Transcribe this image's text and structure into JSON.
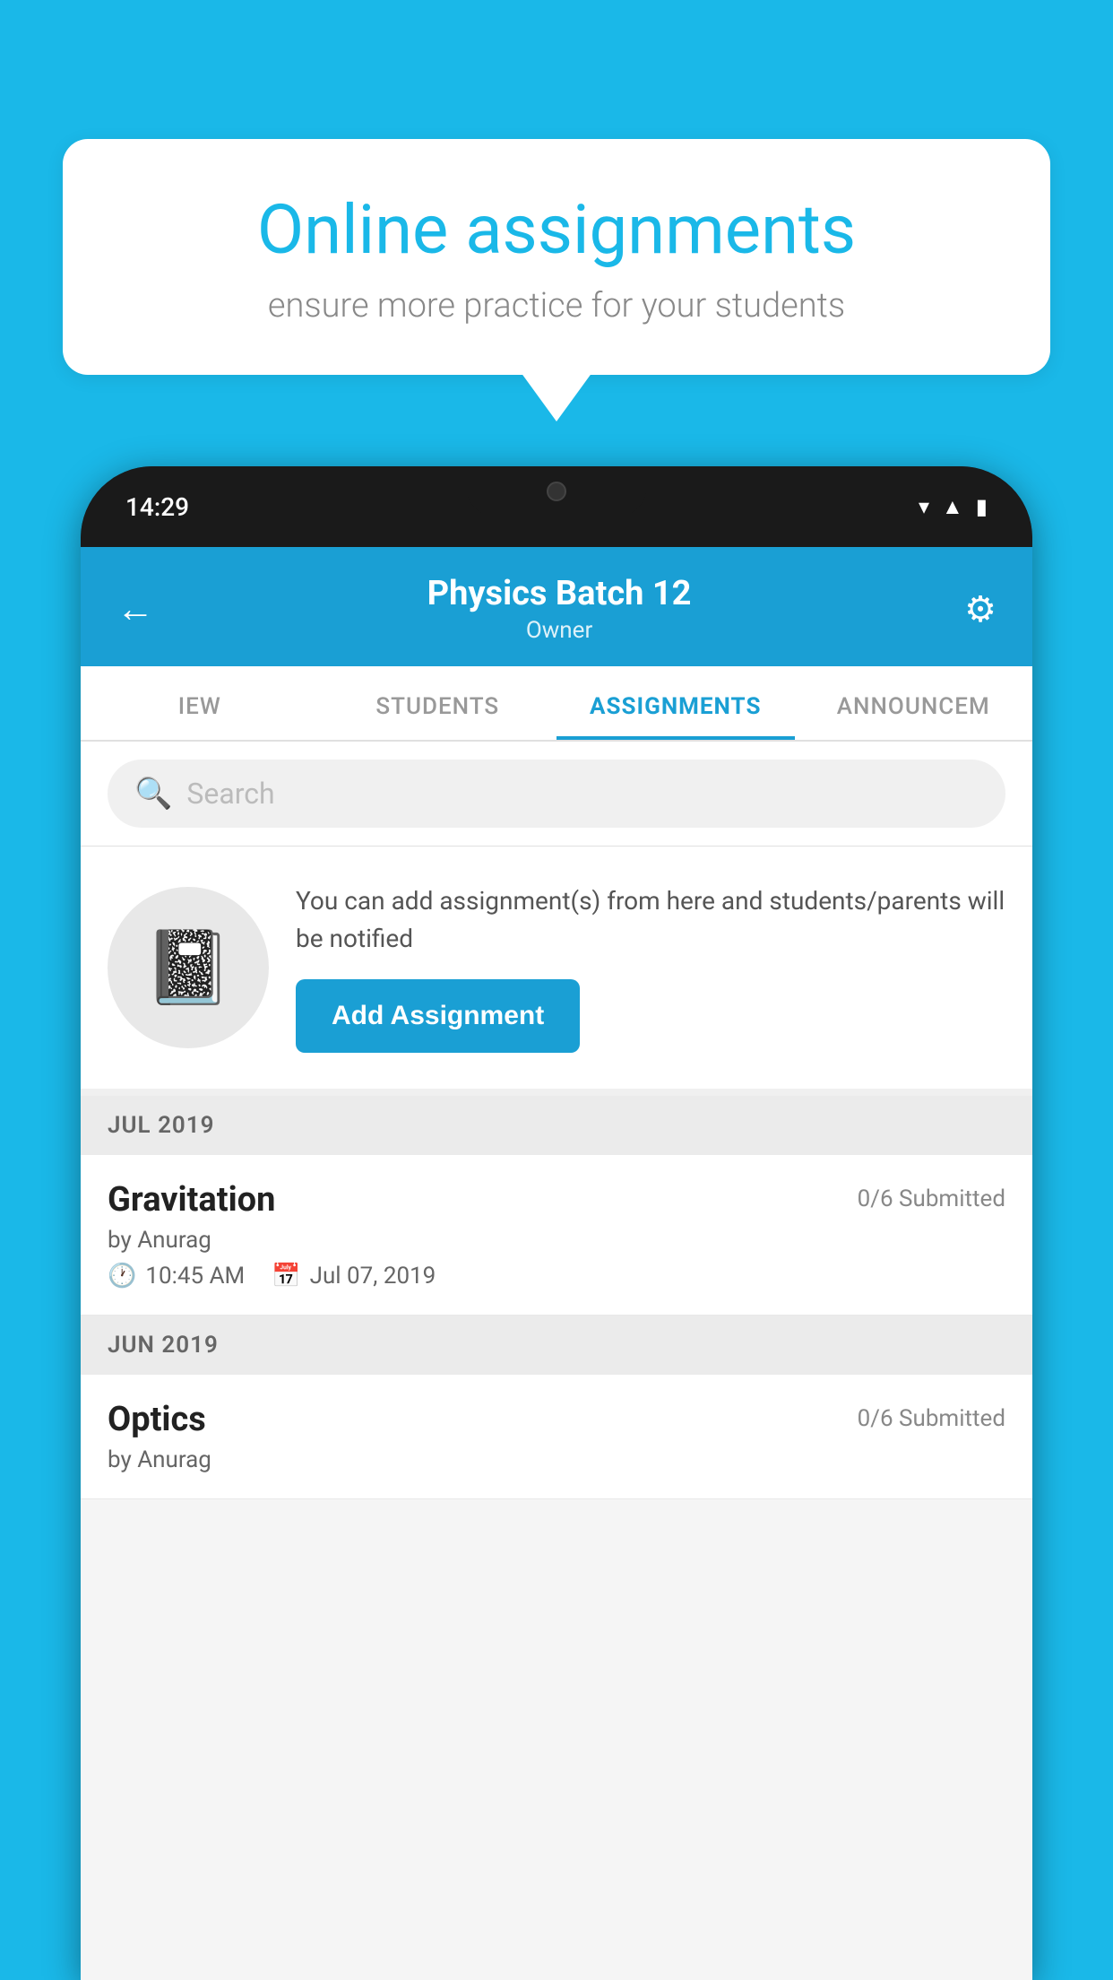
{
  "background_color": "#1ab8e8",
  "speech_bubble": {
    "title": "Online assignments",
    "subtitle": "ensure more practice for your students"
  },
  "phone": {
    "time": "14:29",
    "status_icons": [
      "wifi",
      "signal",
      "battery"
    ]
  },
  "app": {
    "header": {
      "back_label": "←",
      "title": "Physics Batch 12",
      "subtitle": "Owner",
      "gear_label": "⚙"
    },
    "tabs": [
      {
        "label": "IEW",
        "active": false
      },
      {
        "label": "STUDENTS",
        "active": false
      },
      {
        "label": "ASSIGNMENTS",
        "active": true
      },
      {
        "label": "ANNOUNCEM",
        "active": false
      }
    ],
    "search": {
      "placeholder": "Search"
    },
    "promo": {
      "text": "You can add assignment(s) from here and students/parents will be notified",
      "button_label": "Add Assignment"
    },
    "sections": [
      {
        "month_label": "JUL 2019",
        "assignments": [
          {
            "name": "Gravitation",
            "submitted": "0/6 Submitted",
            "author": "by Anurag",
            "time": "10:45 AM",
            "date": "Jul 07, 2019"
          }
        ]
      },
      {
        "month_label": "JUN 2019",
        "assignments": [
          {
            "name": "Optics",
            "submitted": "0/6 Submitted",
            "author": "by Anurag",
            "time": "",
            "date": ""
          }
        ]
      }
    ]
  }
}
